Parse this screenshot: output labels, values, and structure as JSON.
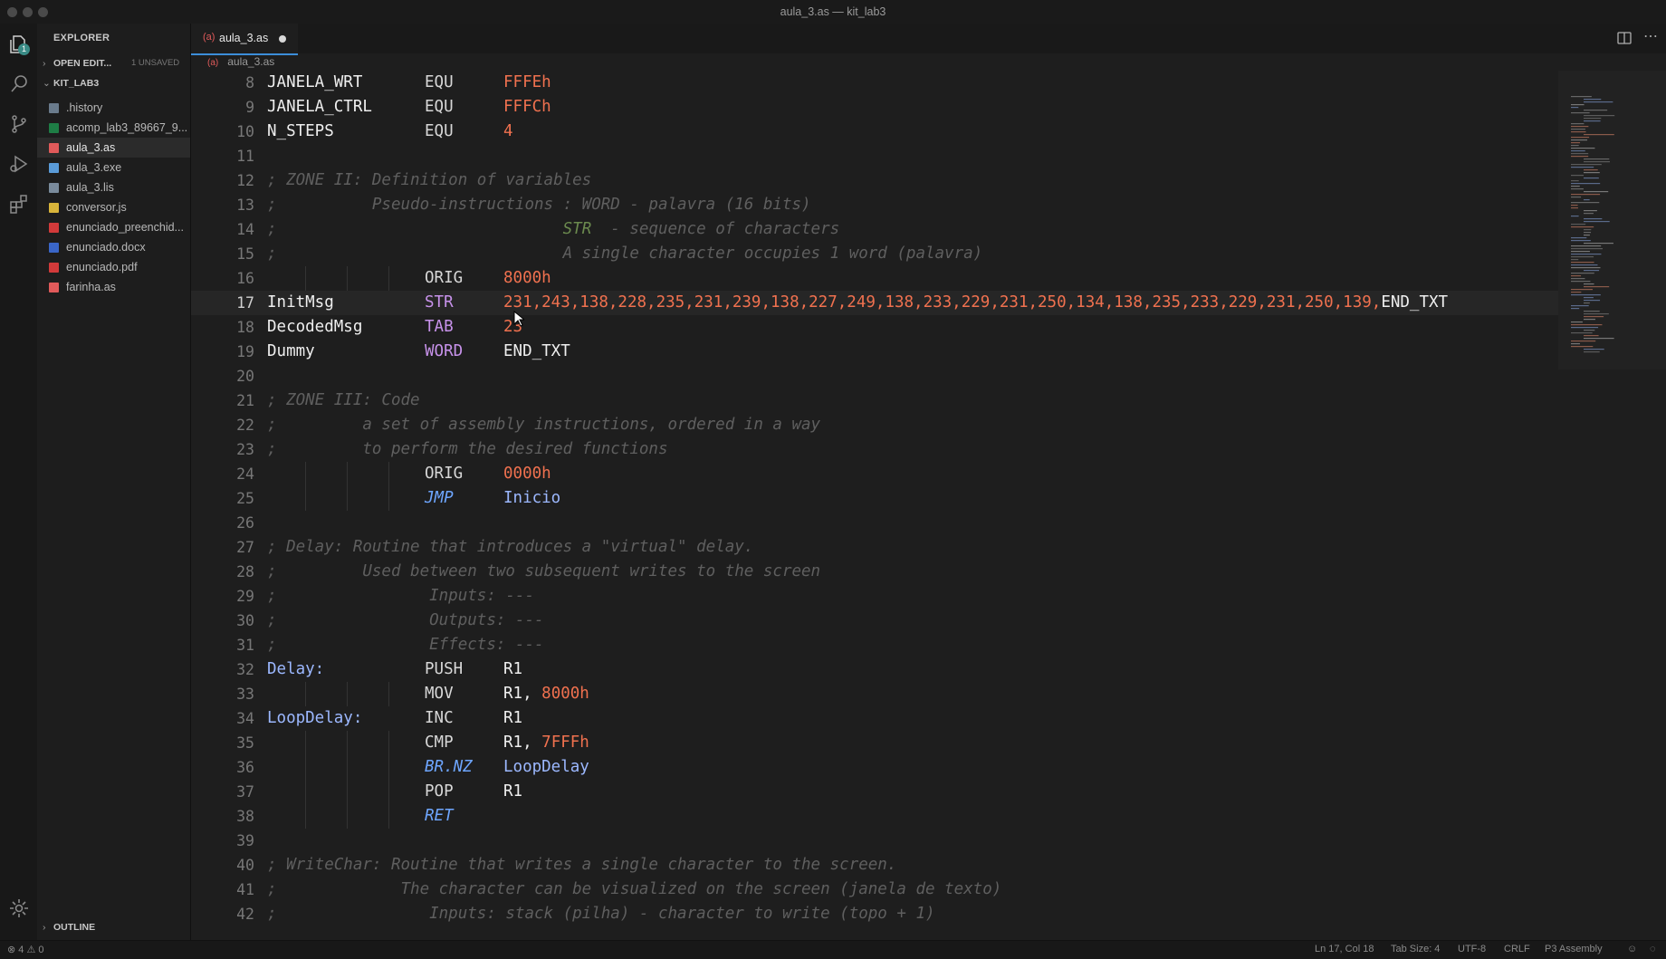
{
  "window": {
    "title": "aula_3.as — kit_lab3"
  },
  "activity_bar": {
    "explorer_badge": "1"
  },
  "sidebar": {
    "title": "EXPLORER",
    "open_editors_label": "OPEN EDIT...",
    "unsaved_label": "1 UNSAVED",
    "folder_label": "KIT_LAB3",
    "files": [
      {
        "name": ".history",
        "icon": "folder-icon",
        "color": "#6a7b8c"
      },
      {
        "name": "acomp_lab3_89667_9...",
        "icon": "excel-file-icon",
        "color": "#1e7d45"
      },
      {
        "name": "aula_3.as",
        "icon": "assembly-file-icon",
        "color": "#e05a5a"
      },
      {
        "name": "aula_3.exe",
        "icon": "exe-file-icon",
        "color": "#5a9bd8"
      },
      {
        "name": "aula_3.lis",
        "icon": "text-file-icon",
        "color": "#7a8b9c"
      },
      {
        "name": "conversor.js",
        "icon": "js-file-icon",
        "color": "#d8b43a"
      },
      {
        "name": "enunciado_preenchid...",
        "icon": "pdf-file-icon",
        "color": "#d23a3a"
      },
      {
        "name": "enunciado.docx",
        "icon": "word-file-icon",
        "color": "#3a66c8"
      },
      {
        "name": "enunciado.pdf",
        "icon": "pdf-file-icon",
        "color": "#d23a3a"
      },
      {
        "name": "farinha.as",
        "icon": "assembly-file-icon",
        "color": "#e05a5a"
      }
    ],
    "outline_label": "OUTLINE"
  },
  "editor": {
    "tab_label": "aula_3.as",
    "tab_icon": "(a)",
    "breadcrumb": "aula_3.as",
    "lines": [
      {
        "n": "8",
        "label": "JANELA_WRT",
        "op": "EQU",
        "arg": "FFFEh"
      },
      {
        "n": "9",
        "label": "JANELA_CTRL",
        "op": "EQU",
        "arg": "FFFCh"
      },
      {
        "n": "10",
        "label": "N_STEPS",
        "op": "EQU",
        "arg": "4"
      },
      {
        "n": "11"
      },
      {
        "n": "12",
        "comment": "; ZONE II: Definition of variables"
      },
      {
        "n": "13",
        "comment": ";          Pseudo-instructions : WORD - palavra (16 bits)"
      },
      {
        "n": "14",
        "comment_a": ";                              ",
        "comment_hl": "STR",
        "comment_b": "  - sequence of characters"
      },
      {
        "n": "15",
        "comment": ";                              A single character occupies 1 word (palavra)"
      },
      {
        "n": "16",
        "op": "ORIG",
        "arg": "8000h"
      },
      {
        "n": "17",
        "label": "InitMsg",
        "op": "STR",
        "arg": "231,243,138,228,235,231,239,138,227,249,138,233,229,231,250,134,138,235,233,229,231,250,139,",
        "arg_tail": "END_TXT"
      },
      {
        "n": "18",
        "label": "DecodedMsg",
        "op": "TAB",
        "arg": "23"
      },
      {
        "n": "19",
        "label": "Dummy",
        "op": "WORD",
        "arg": "END_TXT"
      },
      {
        "n": "20"
      },
      {
        "n": "21",
        "comment": "; ZONE III: Code"
      },
      {
        "n": "22",
        "comment": ";         a set of assembly instructions, ordered in a way"
      },
      {
        "n": "23",
        "comment": ";         to perform the desired functions"
      },
      {
        "n": "24",
        "op": "ORIG",
        "arg": "0000h"
      },
      {
        "n": "25",
        "op": "JMP",
        "arg": "Inicio"
      },
      {
        "n": "26"
      },
      {
        "n": "27",
        "comment": "; Delay: Routine that introduces a \"virtual\" delay."
      },
      {
        "n": "28",
        "comment": ";         Used between two subsequent writes to the screen"
      },
      {
        "n": "29",
        "comment": ";                Inputs: ---"
      },
      {
        "n": "30",
        "comment": ";                Outputs: ---"
      },
      {
        "n": "31",
        "comment": ";                Effects: ---"
      },
      {
        "n": "32",
        "label": "Delay:",
        "op": "PUSH",
        "arg": "R1"
      },
      {
        "n": "33",
        "op": "MOV",
        "arg": "R1, ",
        "arg_num": "8000h"
      },
      {
        "n": "34",
        "label": "LoopDelay:",
        "op": "INC",
        "arg": "R1"
      },
      {
        "n": "35",
        "op": "CMP",
        "arg": "R1, ",
        "arg_num": "7FFFh"
      },
      {
        "n": "36",
        "op": "BR.NZ",
        "arg": "LoopDelay"
      },
      {
        "n": "37",
        "op": "POP",
        "arg": "R1"
      },
      {
        "n": "38",
        "op": "RET"
      },
      {
        "n": "39"
      },
      {
        "n": "40",
        "comment": "; WriteChar: Routine that writes a single character to the screen."
      },
      {
        "n": "41",
        "comment": ";             The character can be visualized on the screen (janela de texto)"
      },
      {
        "n": "42",
        "comment": ";                Inputs: stack (pilha) - character to write (topo + 1)"
      }
    ]
  },
  "status_bar": {
    "errors": "4",
    "warnings": "0",
    "position": "Ln 17, Col 18",
    "tab_size": "Tab Size: 4",
    "encoding": "UTF-8",
    "eol": "CRLF",
    "language": "P3 Assembly"
  }
}
